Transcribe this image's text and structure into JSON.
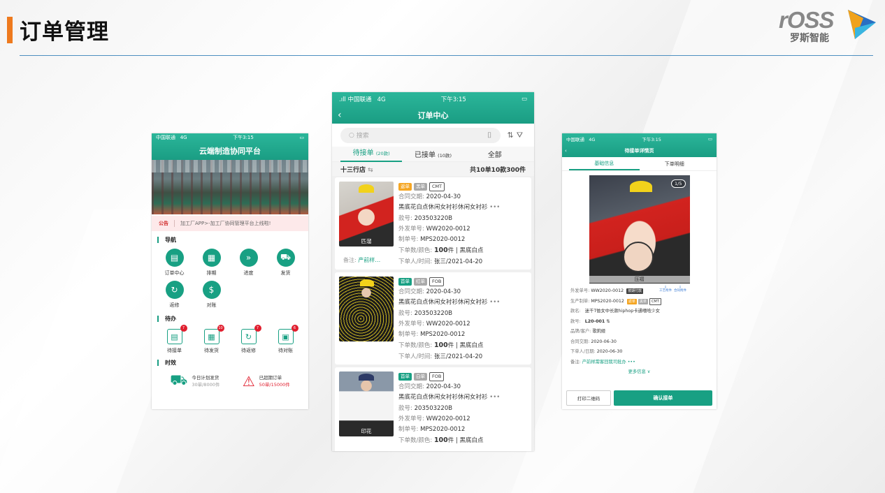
{
  "slide": {
    "title": "订单管理",
    "logo_text": "rOSS",
    "logo_cn": "罗斯智能"
  },
  "phone1": {
    "status": {
      "carrier": "中国联通",
      "network": "4G",
      "time": "下午3:15"
    },
    "title": "云端制造协同平台",
    "notice_label": "公告",
    "notice_text": "加工厂APP>-加工厂协同管理平台上线啦!",
    "nav_title": "导航",
    "nav_items": [
      {
        "label": "订单中心",
        "icon": "order-icon",
        "glyph": "▤"
      },
      {
        "label": "排期",
        "icon": "schedule-icon",
        "glyph": "▦"
      },
      {
        "label": "进度",
        "icon": "progress-icon",
        "glyph": "»"
      },
      {
        "label": "发货",
        "icon": "truck-icon",
        "glyph": "⛟"
      },
      {
        "label": "返修",
        "icon": "repair-icon",
        "glyph": "↻"
      },
      {
        "label": "对账",
        "icon": "moneybag-icon",
        "glyph": "$"
      }
    ],
    "todo_title": "待办",
    "todo_items": [
      {
        "label": "待接单",
        "badge": "7",
        "icon": "pending-order-icon",
        "glyph": "▤"
      },
      {
        "label": "待发货",
        "badge": "10",
        "icon": "pending-ship-icon",
        "glyph": "▦"
      },
      {
        "label": "待返修",
        "badge": "7",
        "icon": "pending-repair-icon",
        "glyph": "↻"
      },
      {
        "label": "待对账",
        "badge": "6",
        "icon": "pending-reconcile-icon",
        "glyph": "▣"
      }
    ],
    "timing_title": "时效",
    "timing": [
      {
        "label": "今日计划发货",
        "sub": "30单/8000件",
        "icon": "delivery-truck-icon"
      },
      {
        "label": "已超期订单",
        "sub": "50单/15000件",
        "icon": "alarm-icon"
      }
    ]
  },
  "phone2": {
    "status": {
      "carrier": "中国联通",
      "network": "4G",
      "time": "下午3:15"
    },
    "title": "订单中心",
    "search_placeholder": "搜索",
    "tabs": [
      {
        "label": "待接单",
        "count": "(20款)"
      },
      {
        "label": "已接单",
        "count": "(10款)"
      },
      {
        "label": "全部",
        "count": ""
      }
    ],
    "shop": "十三行店",
    "total": "共10单10款300件",
    "orders": [
      {
        "tags": [
          {
            "text": "返单",
            "style": "orange"
          },
          {
            "text": "黑单",
            "style": "grey"
          },
          {
            "text": "CMT",
            "style": "outline"
          }
        ],
        "thumb_label": "匹溜",
        "contract_date_label": "合同交期:",
        "contract_date": "2020-04-30",
        "name": "黑底花白点休闲女衬衫休闲女衬衫",
        "style_no_label": "款号:",
        "style_no": "203503220B",
        "outsource_label": "外发单号:",
        "outsource_no": "WW2020-0012",
        "prod_label": "制单号:",
        "prod_no": "MPS2020-0012",
        "qty_label": "下单数/颜色:",
        "qty": "100",
        "qty_unit": "件 | 黑底白点",
        "person_label": "下单人/时间:",
        "person": "张三/2021-04-20",
        "remark_label": "备注:",
        "remark": "产前样…"
      },
      {
        "tags": [
          {
            "text": "首单",
            "style": "green"
          },
          {
            "text": "红单",
            "style": "grey"
          },
          {
            "text": "FOB",
            "style": "outline"
          }
        ],
        "thumb_label": "",
        "contract_date_label": "合同交期:",
        "contract_date": "2020-04-30",
        "name": "黑底花白点休闲女衬衫休闲女衬衫",
        "style_no_label": "款号:",
        "style_no": "203503220B",
        "outsource_label": "外发单号:",
        "outsource_no": "WW2020-0012",
        "prod_label": "制单号:",
        "prod_no": "MPS2020-0012",
        "qty_label": "下单数/颜色:",
        "qty": "100",
        "qty_unit": "件 | 黑底白点",
        "person_label": "下单人/时间:",
        "person": "张三/2021-04-20",
        "remark_label": "",
        "remark": ""
      },
      {
        "tags": [
          {
            "text": "首单",
            "style": "green"
          },
          {
            "text": "白单",
            "style": "grey"
          },
          {
            "text": "FOB",
            "style": "outline"
          }
        ],
        "thumb_label": "印花",
        "contract_date_label": "合同交期:",
        "contract_date": "2020-04-30",
        "name": "黑底花白点休闲女衬衫休闲女衬衫",
        "style_no_label": "款号:",
        "style_no": "203503220B",
        "outsource_label": "外发单号:",
        "outsource_no": "WW2020-0012",
        "prod_label": "制单号:",
        "prod_no": "MPS2020-0012",
        "qty_label": "下单数/颜色:",
        "qty": "100",
        "qty_unit": "件 | 黑底白点",
        "person_label": "",
        "person": "",
        "remark_label": "",
        "remark": ""
      }
    ]
  },
  "phone3": {
    "status": {
      "carrier": "中国联通",
      "network": "4G",
      "time": "下午3:15"
    },
    "title": "待接单详情页",
    "tabs": [
      "基础信息",
      "下单明细"
    ],
    "photo_count": "1/5",
    "photo_label": "压褶",
    "fields": {
      "outsource_label": "外发单号:",
      "outsource_no": "WW2020-0012",
      "outsource_tag": "按期付款",
      "prod_label": "生产制单:",
      "prod_no": "MPS2020-0012",
      "tag1": "返单",
      "tag2": "黑单",
      "tag3": "CMT",
      "name_label": "款名:",
      "name": "迷千T恤女中长款hiphop卡通嘻哈少女",
      "style_label": "款号:",
      "style_no": "L20-001",
      "brand_label": "品牌/客户:",
      "brand": "歌莉娅",
      "contract_label": "合同交期:",
      "contract": "2020-06-30",
      "order_date_label": "下单人/日期:",
      "order_date": "2020-06-30",
      "remark_label": "备注:",
      "remark": "产前样需客回我司批办 •••",
      "tool1": "工艺附件",
      "tool2": "合同附件"
    },
    "more": "更多信息 ∨",
    "print_button": "打印二维码",
    "confirm_button": "确认接单"
  }
}
